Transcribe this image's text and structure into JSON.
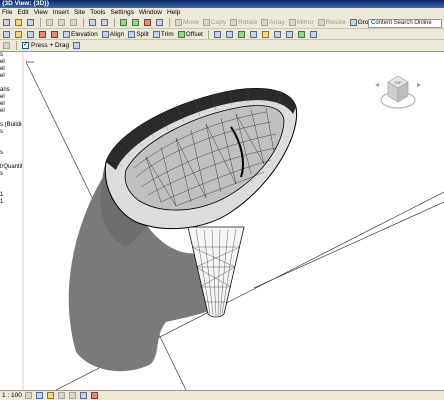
{
  "window": {
    "title": "{3D View: {3D}}"
  },
  "menu": [
    "File",
    "Edit",
    "View",
    "Insert",
    "Site",
    "Tools",
    "Settings",
    "Window",
    "Help"
  ],
  "toolbar1": {
    "items": [
      "Move",
      "Copy",
      "Rotate",
      "Array",
      "Mirror",
      "Resize",
      "Group"
    ]
  },
  "toolbar2": {
    "items": [
      "Elevation",
      "Align",
      "Split",
      "Trim",
      "Offset"
    ]
  },
  "options_bar": {
    "checkbox_label": "Press + Drag",
    "checked": true
  },
  "search": {
    "placeholder": "Content Search Online"
  },
  "left_panel": {
    "items": [
      "s",
      "el",
      "el",
      "el",
      "",
      "ans",
      "el",
      "el",
      "el",
      "",
      "s (Building",
      "s",
      "",
      "",
      "s",
      "",
      "t/Quantitie",
      "s",
      "",
      "",
      "1",
      "1"
    ]
  },
  "status": {
    "scale": "1 : 100"
  },
  "viewcube": {
    "face_label": "TOP"
  },
  "colors": {
    "chrome": "#ece9d8",
    "shadow": "#777777",
    "mesh": "#1a1a1a"
  }
}
